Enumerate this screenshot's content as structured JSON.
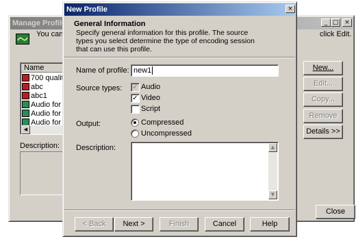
{
  "bg_window": {
    "title": "Manage Profiles",
    "desc_left": "You can c",
    "desc_right": "click Edit.",
    "list_header": "Name",
    "list_items": [
      "700 quality",
      "abc",
      "abc1",
      "Audio for CD",
      "Audio for CD",
      "Audio for dia"
    ],
    "description_label": "Description:",
    "buttons": {
      "new": "New...",
      "edit": "Edit...",
      "copy": "Copy...",
      "remove": "Remove",
      "details": "Details >>",
      "close": "Close"
    },
    "caption_buttons": {
      "minimize": "_",
      "maximize": "□",
      "close": "×"
    }
  },
  "dialog": {
    "title": "New Profile",
    "close_glyph": "×",
    "section_title": "General Information",
    "section_desc": "Specify general information for this profile. The source types you select determine the type of encoding session that can use this profile.",
    "name_label": "Name of profile:",
    "name_value": "new1",
    "source_types_label": "Source types:",
    "source_types": [
      {
        "label": "Audio",
        "checked": true,
        "enabled": false
      },
      {
        "label": "Video",
        "checked": true,
        "enabled": true
      },
      {
        "label": "Script",
        "checked": false,
        "enabled": true
      }
    ],
    "output_label": "Output:",
    "output_options": [
      {
        "label": "Compressed",
        "selected": true
      },
      {
        "label": "Uncompressed",
        "selected": false
      }
    ],
    "description_label": "Description:",
    "buttons": {
      "back": "< Back",
      "next": "Next >",
      "finish": "Finish",
      "cancel": "Cancel",
      "help": "Help"
    }
  },
  "colors": {
    "face": "#d4d0c8",
    "active_title": "#0a246a",
    "inactive_title": "#808080"
  }
}
